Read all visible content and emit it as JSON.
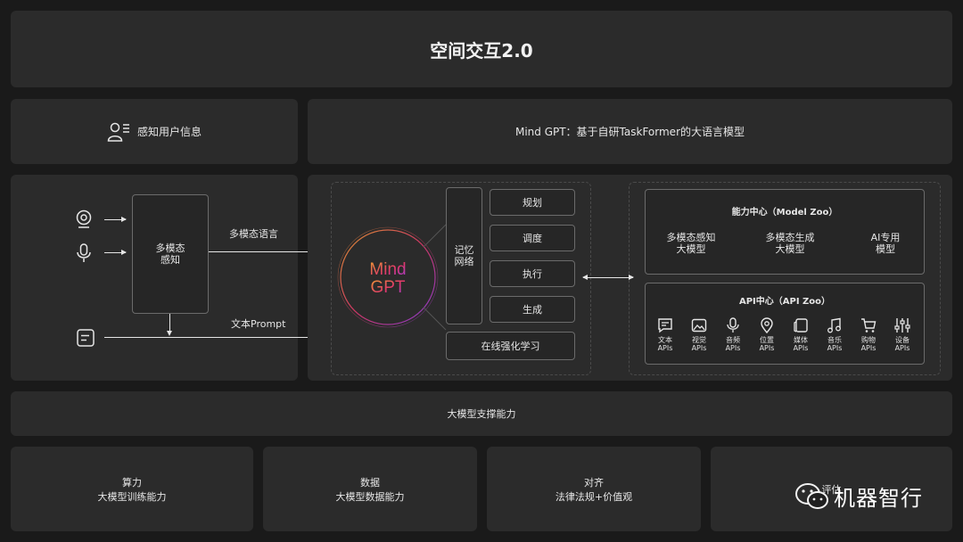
{
  "title": "空间交互2.0",
  "perception": {
    "label": "感知用户信息"
  },
  "mindgpt_header": {
    "label": "Mind GPT：基于自研TaskFormer的大语言模型"
  },
  "left_flow": {
    "multimodal_box": "多模态\n感知",
    "multimodal_language": "多模态语言",
    "text_prompt": "文本Prompt"
  },
  "core": {
    "logo_line1": "Mind",
    "logo_line2": "GPT",
    "memory": "记忆\n网络",
    "tasks": [
      "规划",
      "调度",
      "执行",
      "生成"
    ],
    "online_learning": "在线强化学习"
  },
  "model_zoo": {
    "title": "能力中心（Model Zoo）",
    "items": [
      "多模态感知\n大模型",
      "多模态生成\n大模型",
      "AI专用\n模型"
    ]
  },
  "api_zoo": {
    "title": "API中心（API Zoo）",
    "items": [
      {
        "label": "文本\nAPIs",
        "icon": "text-icon"
      },
      {
        "label": "视觉\nAPIs",
        "icon": "image-icon"
      },
      {
        "label": "音频\nAPIs",
        "icon": "microphone-icon"
      },
      {
        "label": "位置\nAPIs",
        "icon": "location-pin-icon"
      },
      {
        "label": "媒体\nAPIs",
        "icon": "media-icon"
      },
      {
        "label": "音乐\nAPIs",
        "icon": "music-note-icon"
      },
      {
        "label": "购物\nAPIs",
        "icon": "shopping-cart-icon"
      },
      {
        "label": "设备\nAPIs",
        "icon": "sliders-icon"
      }
    ]
  },
  "support": {
    "label": "大模型支撑能力"
  },
  "bottom": [
    {
      "title": "算力",
      "subtitle": "大模型训练能力"
    },
    {
      "title": "数据",
      "subtitle": "大模型数据能力"
    },
    {
      "title": "对齐",
      "subtitle": "法律法规+价值观"
    },
    {
      "title": "评估",
      "subtitle": ""
    }
  ],
  "watermark": {
    "text": "机器智行"
  },
  "colors": {
    "background": "#1a1a1a",
    "panel": "#2b2b2b",
    "logo_start": "#f0a030",
    "logo_mid": "#e0386a",
    "logo_end": "#8a3ce0"
  }
}
